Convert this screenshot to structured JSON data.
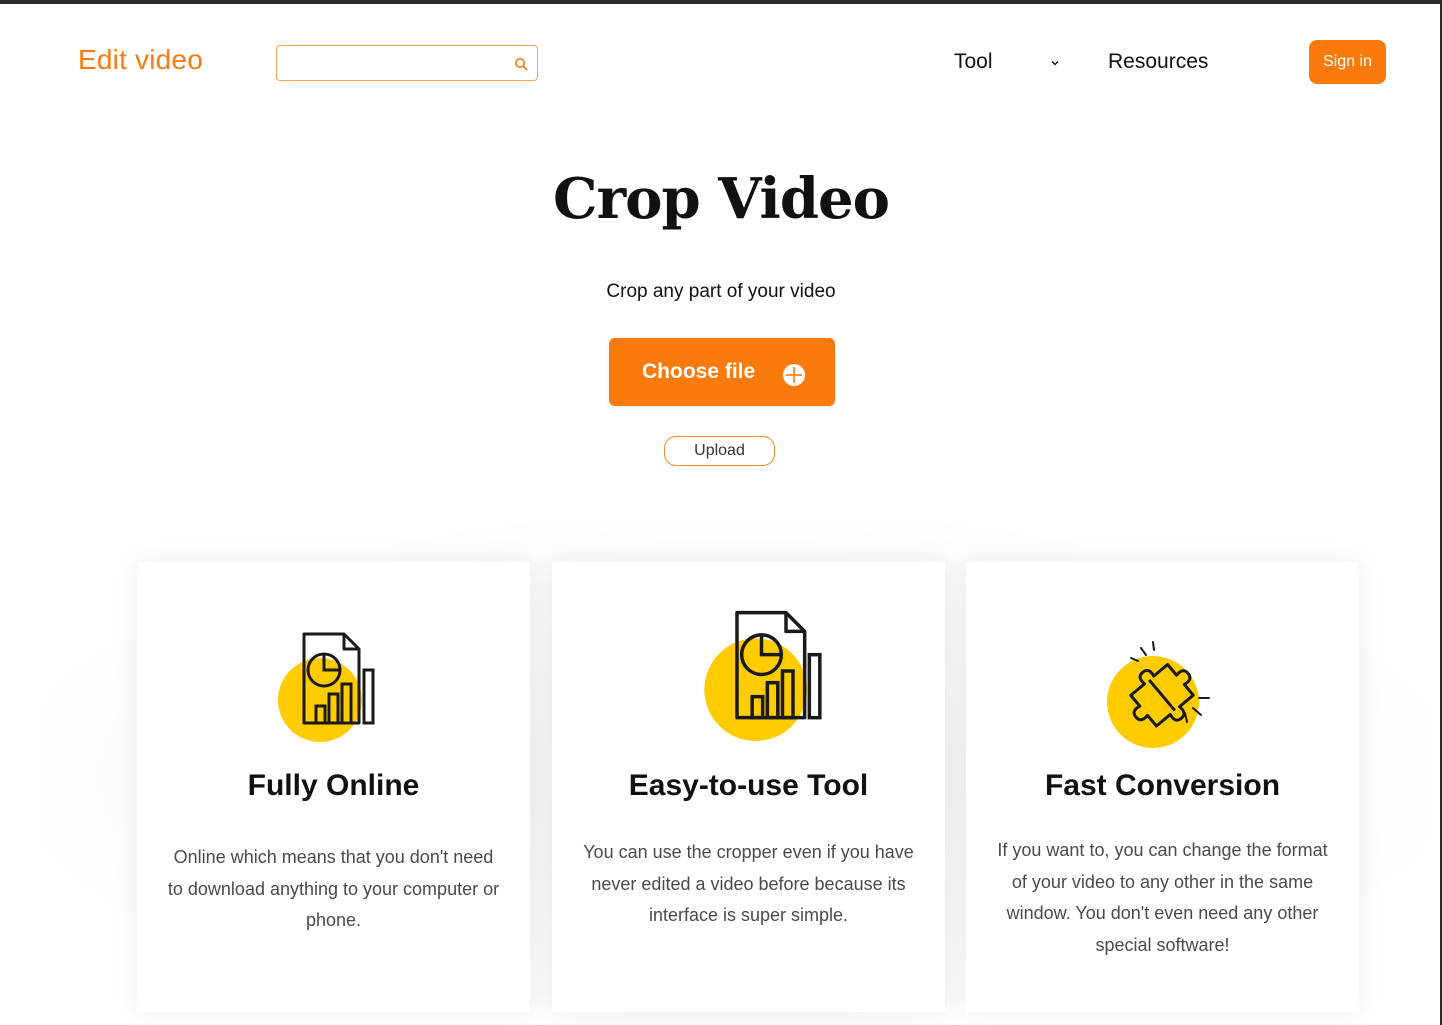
{
  "header": {
    "brand": "Edit video",
    "search_placeholder": "",
    "nav": {
      "tool_label": "Tool",
      "resources_label": "Resources"
    },
    "signin_label": "Sign in"
  },
  "hero": {
    "title": "Crop Video",
    "subtitle": "Crop any part of your video",
    "choose_file_label": "Choose file",
    "upload_label": "Upload"
  },
  "features": [
    {
      "icon": "report-chart-icon",
      "title": "Fully Online",
      "text": "Online which means that you don't need to download anything to your computer or phone."
    },
    {
      "icon": "report-chart-icon",
      "title": "Easy-to-use Tool",
      "text": "You can use the cropper even if you have never edited a video before because its interface is super simple."
    },
    {
      "icon": "puzzle-icon",
      "title": "Fast Conversion",
      "text": "If you want to, you can change the format of your video to any other in the same window. You don't even need any other special software!"
    }
  ],
  "colors": {
    "accent": "#fb7a0c",
    "brand_text": "#f57c13",
    "icon_yellow": "#ffcc00"
  }
}
